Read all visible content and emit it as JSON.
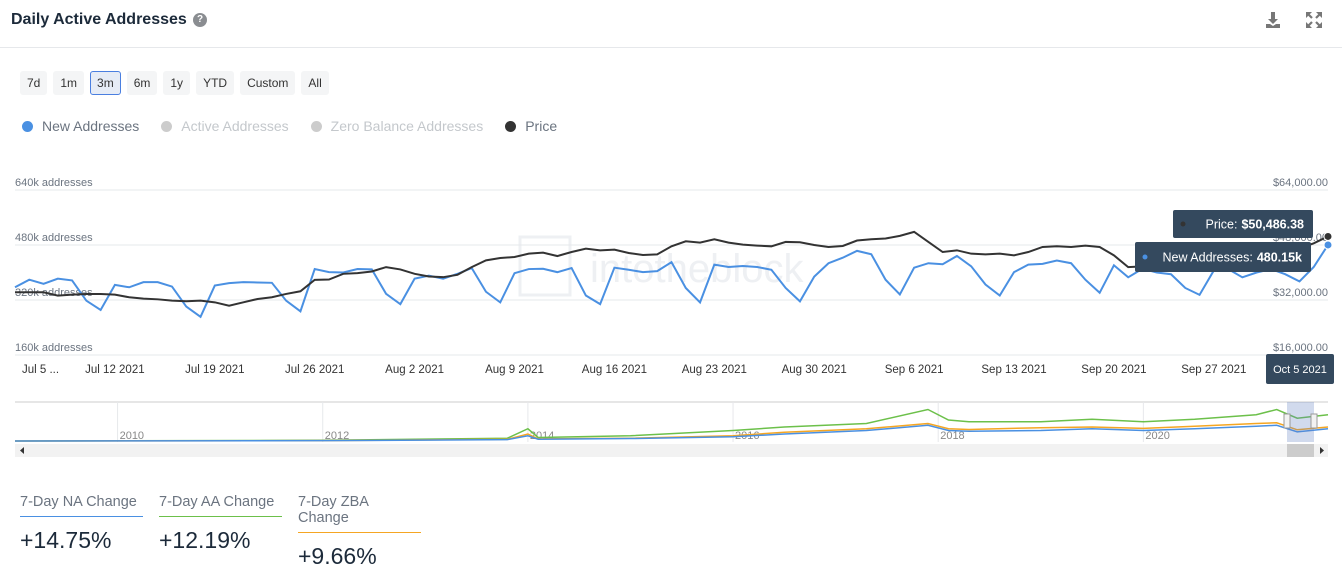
{
  "header": {
    "title": "Daily Active Addresses",
    "help_icon": "question-circle-icon",
    "download_icon": "download-icon",
    "fullscreen_icon": "expand-icon"
  },
  "ranges": [
    {
      "label": "7d"
    },
    {
      "label": "1m"
    },
    {
      "label": "3m",
      "active": true
    },
    {
      "label": "6m"
    },
    {
      "label": "1y"
    },
    {
      "label": "YTD"
    },
    {
      "label": "Custom"
    },
    {
      "label": "All"
    }
  ],
  "legend": [
    {
      "label": "New Addresses",
      "color": "#4a90e2",
      "enabled": true
    },
    {
      "label": "Active Addresses",
      "color": "#cccccc",
      "enabled": false
    },
    {
      "label": "Zero Balance Addresses",
      "color": "#cccccc",
      "enabled": false
    },
    {
      "label": "Price",
      "color": "#333333",
      "enabled": true
    }
  ],
  "chart_data": {
    "type": "line",
    "xlim": [
      "2021-07-05",
      "2021-10-05"
    ],
    "x_interval": "daily",
    "x_ticks": [
      "Jul 5 ...",
      "Jul 12 2021",
      "Jul 19 2021",
      "Jul 26 2021",
      "Aug 2 2021",
      "Aug 9 2021",
      "Aug 16 2021",
      "Aug 23 2021",
      "Aug 30 2021",
      "Sep 6 2021",
      "Sep 13 2021",
      "Sep 20 2021",
      "Sep 27 2021"
    ],
    "y_left": {
      "ticks": [
        "160k addresses",
        "320k addresses",
        "480k addresses",
        "640k addresses"
      ],
      "ylim": [
        160,
        640
      ],
      "unit": "k addresses"
    },
    "y_right": {
      "ticks": [
        "$16,000.00",
        "$32,000.00",
        "$48,000.00",
        "$64,000.00"
      ],
      "ylim": [
        16000,
        64000
      ]
    },
    "grid": true,
    "watermark": "intotheblock",
    "series": [
      {
        "name": "New Addresses",
        "axis": "left",
        "color": "#4a90e2",
        "values": [
          357,
          379,
          367,
          382,
          377,
          318,
          291,
          364,
          357,
          372,
          372,
          359,
          301,
          271,
          362,
          369,
          372,
          371,
          370,
          318,
          287,
          410,
          401,
          400,
          410,
          409,
          338,
          308,
          382,
          391,
          382,
          396,
          413,
          344,
          313,
          398,
          410,
          411,
          401,
          413,
          333,
          308,
          414,
          408,
          401,
          404,
          430,
          355,
          313,
          423,
          416,
          419,
          416,
          408,
          355,
          316,
          388,
          427,
          443,
          463,
          453,
          379,
          336,
          414,
          427,
          424,
          448,
          418,
          365,
          333,
          401,
          423,
          425,
          435,
          427,
          379,
          341,
          421,
          386,
          411,
          400,
          395,
          355,
          335,
          406,
          410,
          386,
          400,
          410,
          395,
          374,
          416,
          480.15
        ]
      },
      {
        "name": "Price",
        "axis": "right",
        "color": "#333333",
        "values": [
          34250,
          34250,
          34250,
          33280,
          33570,
          33760,
          33760,
          33570,
          32790,
          32400,
          32200,
          31810,
          31620,
          31810,
          31320,
          30350,
          31320,
          32300,
          32790,
          33760,
          34540,
          37860,
          37960,
          39620,
          39810,
          40300,
          41570,
          40890,
          39620,
          38840,
          38640,
          39330,
          41570,
          43520,
          44210,
          44500,
          45480,
          45770,
          44790,
          45960,
          46940,
          46450,
          46650,
          45670,
          45080,
          45280,
          47620,
          49090,
          48700,
          49670,
          48700,
          48110,
          47820,
          47620,
          48890,
          48790,
          48010,
          47430,
          47720,
          49300,
          49670,
          49890,
          50650,
          51820,
          48890,
          45960,
          46450,
          45480,
          45280,
          45480,
          44990,
          45960,
          47430,
          47620,
          47430,
          47820,
          47430,
          44990,
          41570,
          41770,
          42500,
          43500,
          44000,
          43500,
          43000,
          42500,
          42000,
          43000,
          44000,
          45500,
          47000,
          48500,
          50486.38
        ]
      }
    ],
    "tooltip": {
      "date": "Oct 5 2021",
      "price_label": "Price:",
      "price_value": "$50,486.38",
      "na_label": "New Addresses:",
      "na_value": "480.15k"
    }
  },
  "navigator": {
    "year_labels": [
      "2010",
      "2012",
      "2014",
      "2016",
      "2018",
      "2020"
    ],
    "xlim": [
      2009,
      2021.8
    ],
    "series": [
      {
        "color": "#6cc04a",
        "points": [
          [
            2009,
            0
          ],
          [
            2012,
            0.02
          ],
          [
            2013.8,
            0.08
          ],
          [
            2014,
            0.35
          ],
          [
            2014.1,
            0.1
          ],
          [
            2015,
            0.15
          ],
          [
            2016,
            0.3
          ],
          [
            2016.5,
            0.4
          ],
          [
            2017.3,
            0.5
          ],
          [
            2017.9,
            0.9
          ],
          [
            2018.1,
            0.6
          ],
          [
            2018.3,
            0.55
          ],
          [
            2019,
            0.55
          ],
          [
            2019.5,
            0.62
          ],
          [
            2020,
            0.55
          ],
          [
            2020.5,
            0.62
          ],
          [
            2021.1,
            0.75
          ],
          [
            2021.3,
            0.9
          ],
          [
            2021.5,
            0.65
          ],
          [
            2021.8,
            0.75
          ]
        ]
      },
      {
        "color": "#f5a623",
        "points": [
          [
            2009,
            0
          ],
          [
            2012,
            0.01
          ],
          [
            2013.8,
            0.05
          ],
          [
            2014,
            0.2
          ],
          [
            2014.1,
            0.06
          ],
          [
            2015,
            0.08
          ],
          [
            2016,
            0.15
          ],
          [
            2016.5,
            0.25
          ],
          [
            2017.3,
            0.35
          ],
          [
            2017.9,
            0.5
          ],
          [
            2018.1,
            0.35
          ],
          [
            2018.3,
            0.33
          ],
          [
            2019,
            0.38
          ],
          [
            2019.5,
            0.4
          ],
          [
            2020,
            0.36
          ],
          [
            2020.5,
            0.42
          ],
          [
            2021.1,
            0.5
          ],
          [
            2021.3,
            0.52
          ],
          [
            2021.5,
            0.32
          ],
          [
            2021.8,
            0.4
          ]
        ]
      },
      {
        "color": "#4a90e2",
        "points": [
          [
            2009,
            0
          ],
          [
            2012,
            0.01
          ],
          [
            2013.8,
            0.04
          ],
          [
            2014,
            0.15
          ],
          [
            2014.1,
            0.05
          ],
          [
            2015,
            0.07
          ],
          [
            2016,
            0.12
          ],
          [
            2016.5,
            0.2
          ],
          [
            2017.3,
            0.3
          ],
          [
            2017.9,
            0.45
          ],
          [
            2018.1,
            0.3
          ],
          [
            2018.3,
            0.28
          ],
          [
            2019,
            0.3
          ],
          [
            2019.5,
            0.35
          ],
          [
            2020,
            0.3
          ],
          [
            2020.5,
            0.35
          ],
          [
            2021.1,
            0.42
          ],
          [
            2021.3,
            0.45
          ],
          [
            2021.5,
            0.26
          ],
          [
            2021.8,
            0.35
          ]
        ]
      }
    ]
  },
  "stats": [
    {
      "label": "7-Day NA Change",
      "value": "+14.75%",
      "color": "#4a90e2"
    },
    {
      "label": "7-Day AA Change",
      "value": "+12.19%",
      "color": "#6cc04a"
    },
    {
      "label": "7-Day ZBA Change",
      "value": "+9.66%",
      "color": "#f5a623"
    }
  ]
}
